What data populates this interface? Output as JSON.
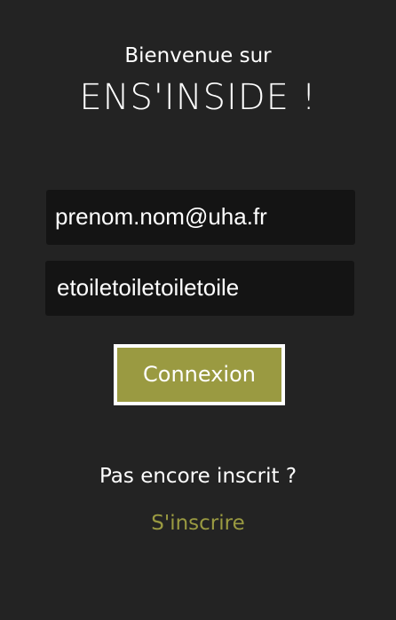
{
  "header": {
    "welcome": "Bienvenue sur",
    "app_name": "ENS'INSIDE !"
  },
  "form": {
    "email_value": "prenom.nom@uha.fr",
    "password_value": "etoiletoiletoiletoile",
    "submit_label": "Connexion"
  },
  "footer": {
    "prompt": "Pas encore inscrit ?",
    "signup_label": "S'inscrire"
  },
  "colors": {
    "background": "#232323",
    "field_background": "#141414",
    "accent": "#9a9a41",
    "text": "#ffffff"
  }
}
